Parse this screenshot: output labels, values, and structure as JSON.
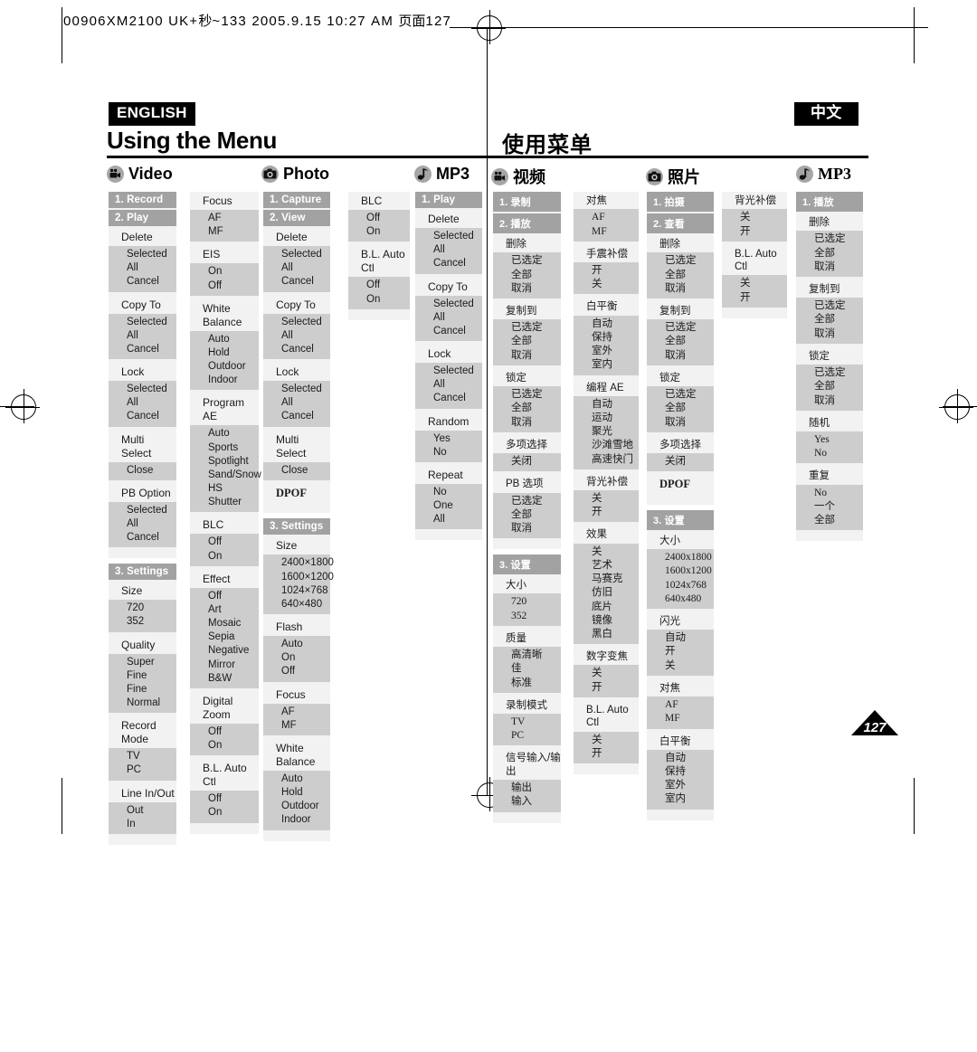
{
  "print_slug": {
    "text_left": "00906XM2100 UK+",
    "text_cjk1": "秒",
    "text_mid": "~133  2005.9.15 10:27 AM  ",
    "text_cjk2": "页面",
    "text_page": "127"
  },
  "header": {
    "lang_en": "ENGLISH",
    "lang_zh": "中文",
    "title_en": "Using the Menu",
    "title_zh": "使用菜单"
  },
  "categories": [
    {
      "icon": "camcorder-icon",
      "label": "Video"
    },
    {
      "icon": "camera-icon",
      "label": "Photo"
    },
    {
      "icon": "music-note-icon",
      "label": "MP3"
    },
    {
      "icon": "camcorder-icon",
      "label": "视频"
    },
    {
      "icon": "camera-icon",
      "label": "照片"
    },
    {
      "icon": "music-note-icon",
      "label": "MP3"
    }
  ],
  "page_number": "127",
  "menus": {
    "video_en_a": {
      "bars": [
        "1. Record",
        "2. Play"
      ],
      "groups": [
        {
          "label": "Delete",
          "options": [
            "Selected",
            "All",
            "Cancel"
          ]
        },
        {
          "label": "Copy To",
          "options": [
            "Selected",
            "All",
            "Cancel"
          ]
        },
        {
          "label": "Lock",
          "options": [
            "Selected",
            "All",
            "Cancel"
          ]
        },
        {
          "label": "Multi Select",
          "options": [
            "Close"
          ]
        },
        {
          "label": "PB Option",
          "options": [
            "Selected",
            "All",
            "Cancel"
          ]
        }
      ],
      "settings_bar": "3. Settings",
      "settings_groups": [
        {
          "label": "Size",
          "options": [
            "720",
            "352"
          ]
        },
        {
          "label": "Quality",
          "options": [
            "Super Fine",
            "Fine",
            "Normal"
          ]
        },
        {
          "label": "Record Mode",
          "options": [
            "TV",
            "PC"
          ]
        },
        {
          "label": "Line In/Out",
          "options": [
            "Out",
            "In"
          ]
        }
      ]
    },
    "video_en_b": {
      "groups": [
        {
          "label": "Focus",
          "options": [
            "AF",
            "MF"
          ]
        },
        {
          "label": "EIS",
          "options": [
            "On",
            "Off"
          ]
        },
        {
          "label": "White Balance",
          "options": [
            "Auto",
            "Hold",
            "Outdoor",
            "Indoor"
          ]
        },
        {
          "label": "Program AE",
          "options": [
            "Auto",
            "Sports",
            "Spotlight",
            "Sand/Snow",
            "HS Shutter"
          ]
        },
        {
          "label": "BLC",
          "options": [
            "Off",
            "On"
          ]
        },
        {
          "label": "Effect",
          "options": [
            "Off",
            "Art",
            "Mosaic",
            "Sepia",
            "Negative",
            "Mirror",
            "B&W"
          ]
        },
        {
          "label": "Digital Zoom",
          "options": [
            "Off",
            "On"
          ]
        },
        {
          "label": "B.L. Auto Ctl",
          "options": [
            "Off",
            "On"
          ]
        }
      ]
    },
    "photo_en_a": {
      "bars": [
        "1. Capture",
        "2. View"
      ],
      "groups": [
        {
          "label": "Delete",
          "options": [
            "Selected",
            "All",
            "Cancel"
          ]
        },
        {
          "label": "Copy To",
          "options": [
            "Selected",
            "All",
            "Cancel"
          ]
        },
        {
          "label": "Lock",
          "options": [
            "Selected",
            "All",
            "Cancel"
          ]
        },
        {
          "label": "Multi Select",
          "options": [
            "Close"
          ]
        },
        {
          "label": "DPOF",
          "options": []
        }
      ],
      "settings_bar": "3. Settings",
      "settings_groups": [
        {
          "label": "Size",
          "options": [
            "2400×1800",
            "1600×1200",
            "1024×768",
            "640×480"
          ]
        },
        {
          "label": "Flash",
          "options": [
            "Auto",
            "On",
            "Off"
          ]
        },
        {
          "label": "Focus",
          "options": [
            "AF",
            "MF"
          ]
        },
        {
          "label": "White Balance",
          "options": [
            "Auto",
            "Hold",
            "Outdoor",
            "Indoor"
          ]
        }
      ]
    },
    "photo_en_b": {
      "groups": [
        {
          "label": "BLC",
          "options": [
            "Off",
            "On"
          ]
        },
        {
          "label": "B.L. Auto Ctl",
          "options": [
            "Off",
            "On"
          ]
        }
      ]
    },
    "mp3_en": {
      "bars": [
        "1. Play"
      ],
      "groups": [
        {
          "label": "Delete",
          "options": [
            "Selected",
            "All",
            "Cancel"
          ]
        },
        {
          "label": "Copy To",
          "options": [
            "Selected",
            "All",
            "Cancel"
          ]
        },
        {
          "label": "Lock",
          "options": [
            "Selected",
            "All",
            "Cancel"
          ]
        },
        {
          "label": "Random",
          "options": [
            "Yes",
            "No"
          ]
        },
        {
          "label": "Repeat",
          "options": [
            "No",
            "One",
            "All"
          ]
        }
      ]
    },
    "video_zh_a": {
      "bars": [
        "1. 录制",
        "2. 播放"
      ],
      "groups": [
        {
          "label": "删除",
          "options": [
            "已选定",
            "全部",
            "取消"
          ]
        },
        {
          "label": "复制到",
          "options": [
            "已选定",
            "全部",
            "取消"
          ]
        },
        {
          "label": "锁定",
          "options": [
            "已选定",
            "全部",
            "取消"
          ]
        },
        {
          "label": "多项选择",
          "options": [
            "关闭"
          ]
        },
        {
          "label": "PB 选项",
          "options": [
            "已选定",
            "全部",
            "取消"
          ]
        }
      ],
      "settings_bar": "3. 设置",
      "settings_groups": [
        {
          "label": "大小",
          "options": [
            "720",
            "352"
          ]
        },
        {
          "label": "质量",
          "options": [
            "高清晰",
            "佳",
            "标准"
          ]
        },
        {
          "label": "录制模式",
          "options": [
            "TV",
            "PC"
          ]
        },
        {
          "label": "信号输入/输出",
          "options": [
            "输出",
            "输入"
          ]
        }
      ]
    },
    "video_zh_b": {
      "groups": [
        {
          "label": "对焦",
          "options": [
            "AF",
            "MF"
          ]
        },
        {
          "label": "手震补偿",
          "options": [
            "开",
            "关"
          ]
        },
        {
          "label": "白平衡",
          "options": [
            "自动",
            "保持",
            "室外",
            "室内"
          ]
        },
        {
          "label": "编程 AE",
          "options": [
            "自动",
            "运动",
            "聚光",
            "沙滩雪地",
            "高速快门"
          ]
        },
        {
          "label": "背光补偿",
          "options": [
            "关",
            "开"
          ]
        },
        {
          "label": "效果",
          "options": [
            "关",
            "艺术",
            "马赛克",
            "仿旧",
            "底片",
            "镜像",
            "黑白"
          ]
        },
        {
          "label": "数字变焦",
          "options": [
            "关",
            "开"
          ]
        },
        {
          "label": "B.L. Auto Ctl",
          "options": [
            "关",
            "开"
          ]
        }
      ]
    },
    "photo_zh_a": {
      "bars": [
        "1. 拍摄",
        "2. 查看"
      ],
      "groups": [
        {
          "label": "删除",
          "options": [
            "已选定",
            "全部",
            "取消"
          ]
        },
        {
          "label": "复制到",
          "options": [
            "已选定",
            "全部",
            "取消"
          ]
        },
        {
          "label": "锁定",
          "options": [
            "已选定",
            "全部",
            "取消"
          ]
        },
        {
          "label": "多项选择",
          "options": [
            "关闭"
          ]
        },
        {
          "label": "DPOF",
          "options": []
        }
      ],
      "settings_bar": "3. 设置",
      "settings_groups": [
        {
          "label": "大小",
          "options": [
            "2400x1800",
            "1600x1200",
            "1024x768",
            "640x480"
          ]
        },
        {
          "label": "闪光",
          "options": [
            "自动",
            "开",
            "关"
          ]
        },
        {
          "label": "对焦",
          "options": [
            "AF",
            "MF"
          ]
        },
        {
          "label": "白平衡",
          "options": [
            "自动",
            "保持",
            "室外",
            "室内"
          ]
        }
      ]
    },
    "photo_zh_b": {
      "groups": [
        {
          "label": "背光补偿",
          "options": [
            "关",
            "开"
          ]
        },
        {
          "label": "B.L. Auto Ctl",
          "options": [
            "关",
            "开"
          ]
        }
      ]
    },
    "mp3_zh": {
      "bars": [
        "1. 播放"
      ],
      "groups": [
        {
          "label": "删除",
          "options": [
            "已选定",
            "全部",
            "取消"
          ]
        },
        {
          "label": "复制到",
          "options": [
            "已选定",
            "全部",
            "取消"
          ]
        },
        {
          "label": "锁定",
          "options": [
            "已选定",
            "全部",
            "取消"
          ]
        },
        {
          "label": "随机",
          "options": [
            "Yes",
            "No"
          ]
        },
        {
          "label": "重复",
          "options": [
            "No",
            "一个",
            "全部"
          ]
        }
      ]
    }
  }
}
